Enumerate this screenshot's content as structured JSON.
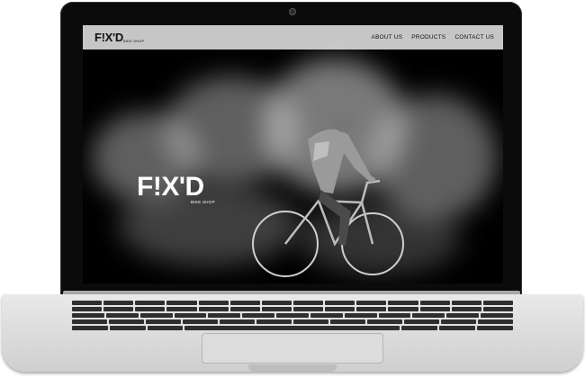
{
  "site": {
    "logo": "F!X'D",
    "logo_subtitle": "BIKE SHOP",
    "nav": [
      {
        "label": "ABOUT US"
      },
      {
        "label": "PRODUCTS"
      },
      {
        "label": "CONTACT US"
      }
    ]
  },
  "hero": {
    "logo": "F!X'D",
    "subtitle": "BIKE SHOP"
  }
}
